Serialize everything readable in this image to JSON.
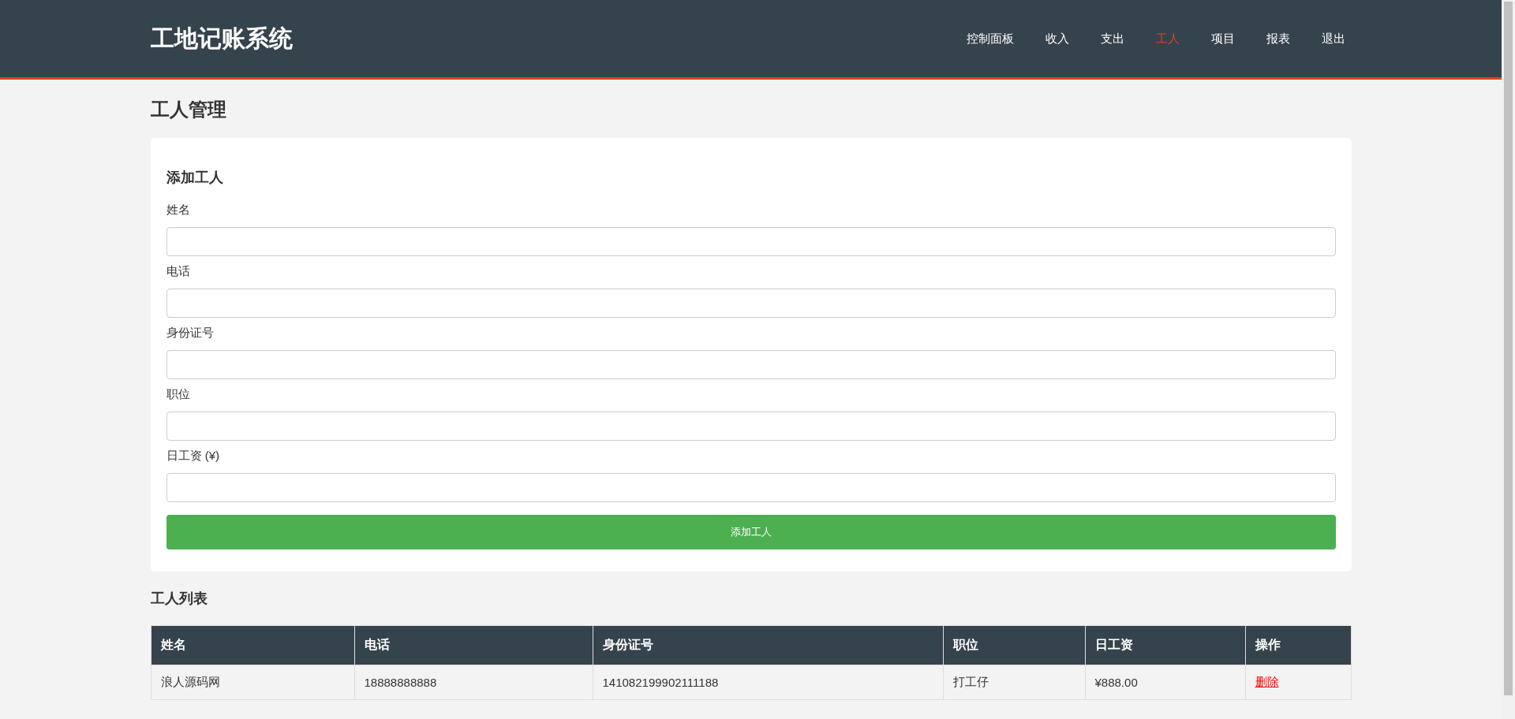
{
  "header": {
    "logo": "工地记账系统",
    "nav": [
      {
        "label": "控制面板",
        "selected": false
      },
      {
        "label": "收入",
        "selected": false
      },
      {
        "label": "支出",
        "selected": false
      },
      {
        "label": "工人",
        "selected": true
      },
      {
        "label": "项目",
        "selected": false
      },
      {
        "label": "报表",
        "selected": false
      },
      {
        "label": "退出",
        "selected": false
      }
    ]
  },
  "page_title": "工人管理",
  "form": {
    "title": "添加工人",
    "fields": [
      {
        "label": "姓名"
      },
      {
        "label": "电话"
      },
      {
        "label": "身份证号"
      },
      {
        "label": "职位"
      },
      {
        "label": "日工资 (¥)"
      }
    ],
    "submit": "添加工人"
  },
  "table": {
    "title": "工人列表",
    "columns": [
      "姓名",
      "电话",
      "身份证号",
      "职位",
      "日工资",
      "操作"
    ],
    "rows": [
      {
        "cells": [
          "浪人源码网",
          "18888888888",
          "141082199902111188",
          "打工仔",
          "¥888.00"
        ],
        "action": "删除"
      }
    ]
  }
}
